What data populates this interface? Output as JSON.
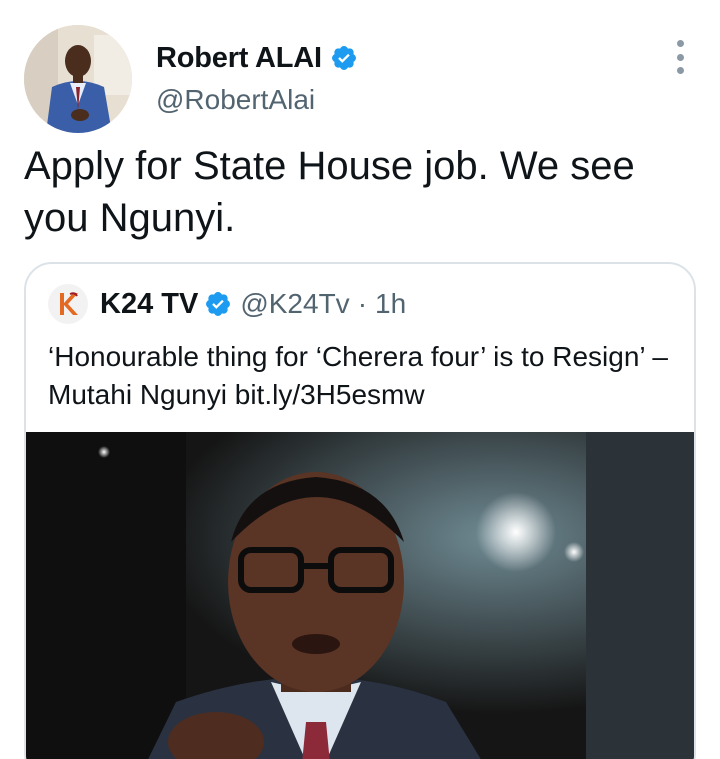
{
  "tweet": {
    "author": {
      "name": "Robert ALAI",
      "handle": "@RobertAlai"
    },
    "text": "Apply for State House job. We see you Ngunyi.",
    "quote": {
      "author_name": "K24 TV",
      "handle": "@K24Tv",
      "separator": "·",
      "time": "1h",
      "text": "‘Honourable thing for ‘Cherera four’ is to Resign’ – Mutahi Ngunyi bit.ly/3H5esmw"
    }
  },
  "colors": {
    "verified": "#1d9bf0",
    "secondary_text": "#536471",
    "border": "#dce3e8"
  },
  "icons": {
    "verified": "verified-badge-icon",
    "more": "more-options-icon"
  }
}
